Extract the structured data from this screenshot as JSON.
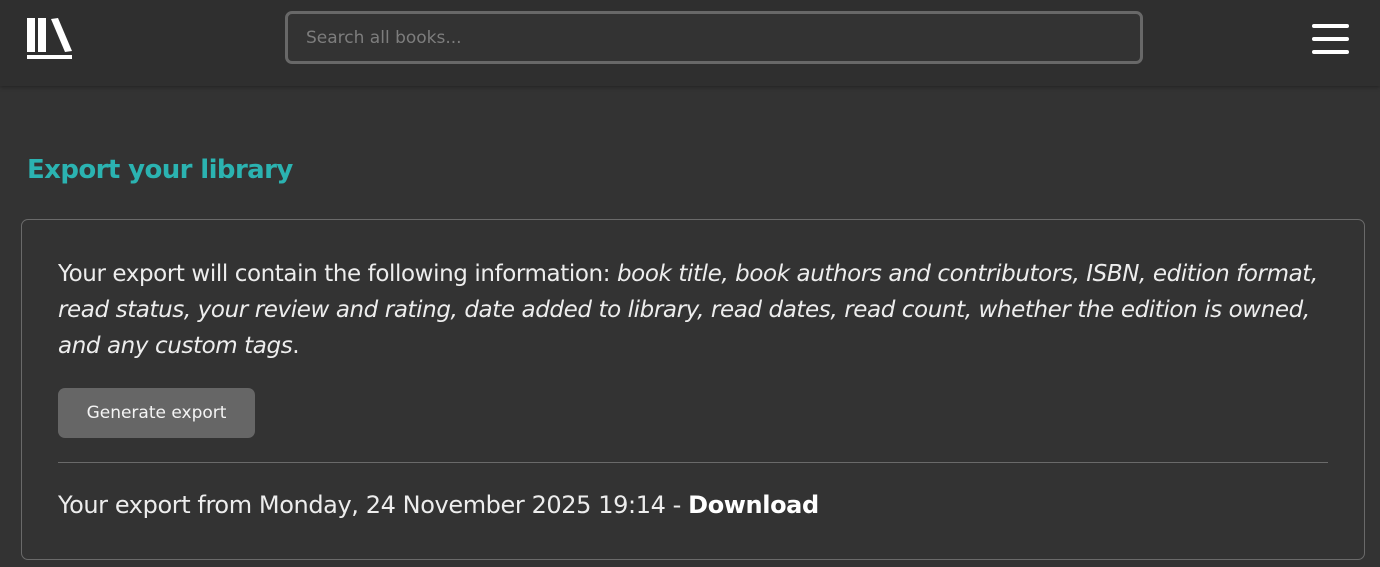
{
  "header": {
    "logo_icon": "bookshelf-icon",
    "search": {
      "placeholder": "Search all books...",
      "value": ""
    },
    "menu_icon": "hamburger-menu-icon"
  },
  "main": {
    "title": "Export your library",
    "title_color": "#2bb3b1",
    "info": {
      "lead": "Your export will contain the following information: ",
      "fields": "book title, book authors and contributors, ISBN, edition format, read status, your review and rating, date added to library, read dates, read count, whether the edition is owned, and any custom tags",
      "end": "."
    },
    "generate_button_label": "Generate export",
    "export": {
      "prefix": "Your export from Monday, 24 November 2025 19:14 - ",
      "download_label": "Download"
    }
  }
}
